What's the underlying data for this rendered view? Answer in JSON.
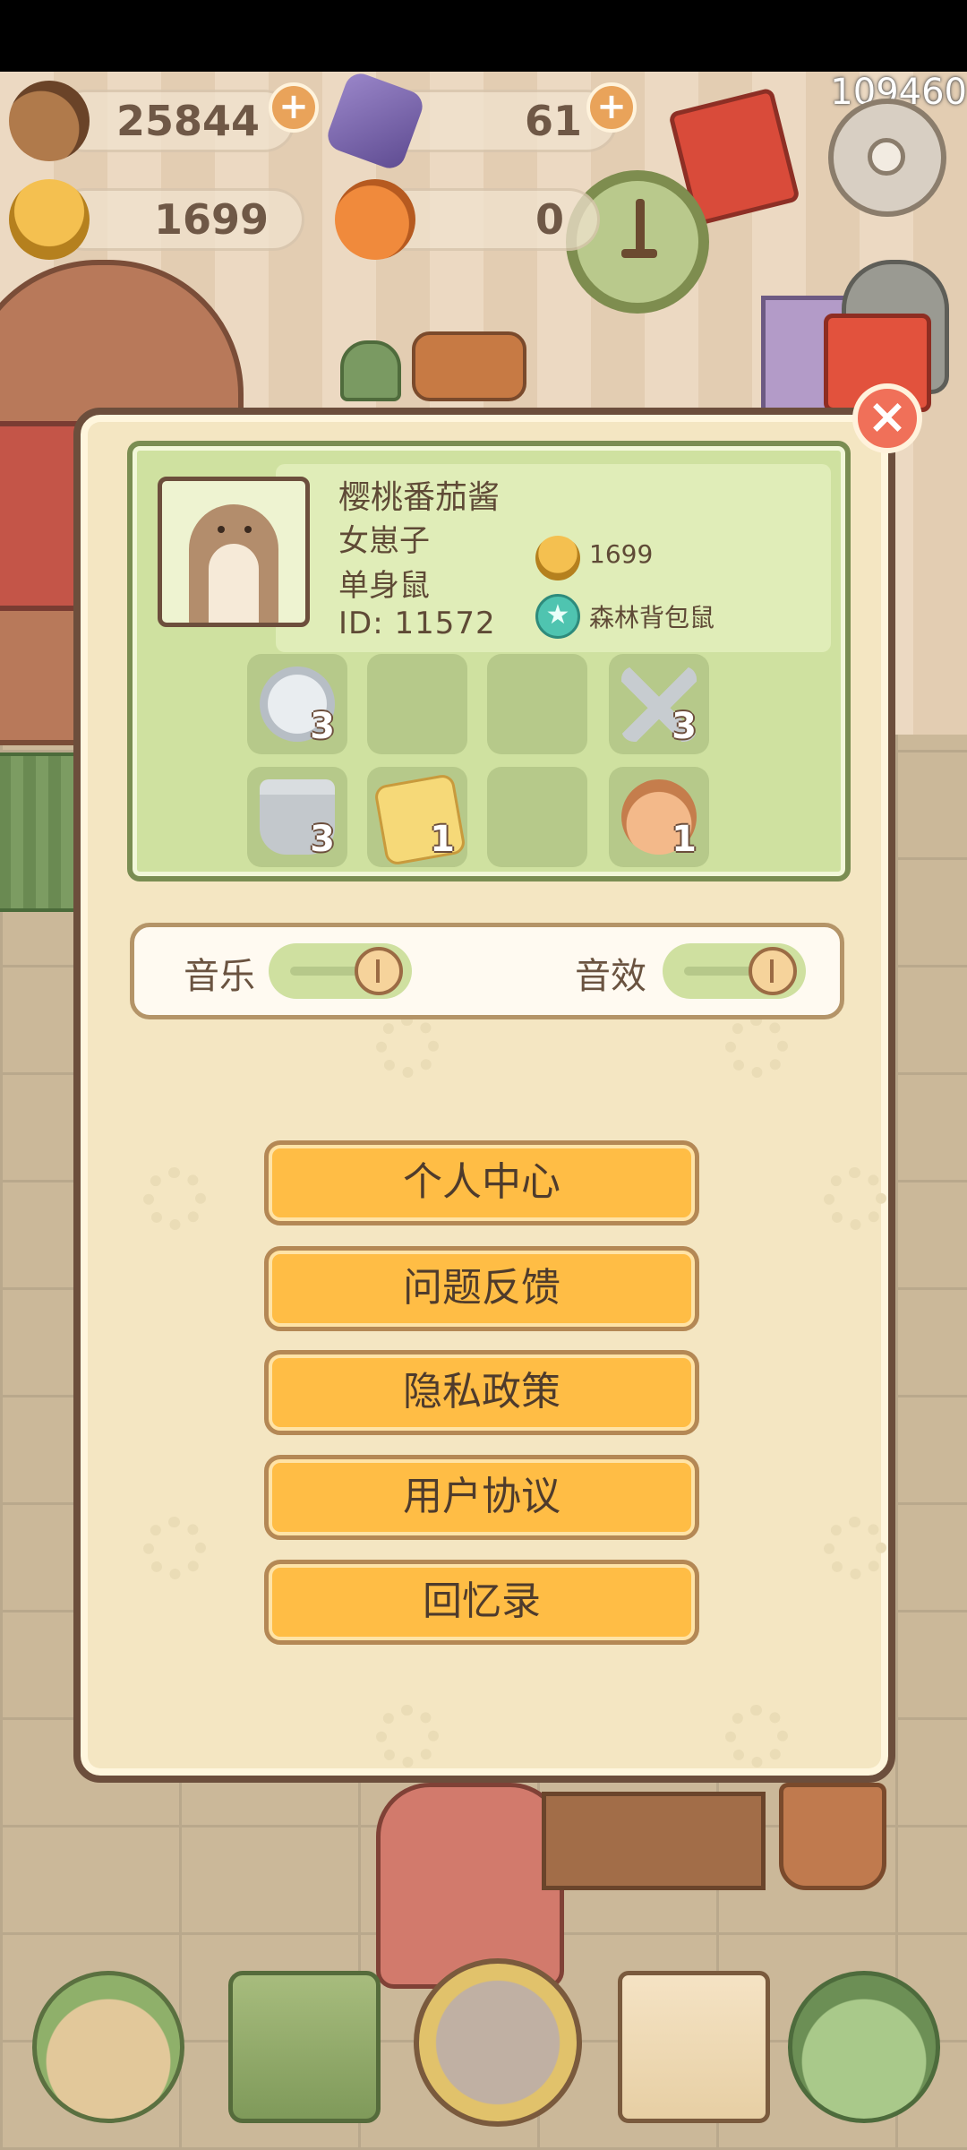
{
  "hud": {
    "points": "109460",
    "acorns": "25844",
    "gems": "61",
    "bells": "1699",
    "oranges": "0"
  },
  "profile": {
    "name": "樱桃番茄酱",
    "gender": "女崽子",
    "relationship": "单身鼠",
    "id": "ID: 11572",
    "bell_count": "1699",
    "badge_title": "森林背包鼠"
  },
  "inventory": [
    {
      "icon": "cabbage-icon",
      "count": "3"
    },
    {
      "icon": "",
      "count": ""
    },
    {
      "icon": "",
      "count": ""
    },
    {
      "icon": "scissors-icon",
      "count": "3"
    },
    {
      "icon": "pot-icon",
      "count": "3"
    },
    {
      "icon": "star-cards-icon",
      "count": "1"
    },
    {
      "icon": "",
      "count": ""
    },
    {
      "icon": "paw-icon",
      "count": "1"
    }
  ],
  "settings": {
    "music_label": "音乐",
    "sfx_label": "音效",
    "music_on": true,
    "sfx_on": true
  },
  "menu": {
    "personal_center": "个人中心",
    "feedback": "问题反馈",
    "privacy_policy": "隐私政策",
    "user_agreement": "用户协议",
    "memories": "回忆录"
  },
  "close_label": "×",
  "colors": {
    "panel_bg": "#f4e6c2",
    "button_orange": "#ffbd45",
    "profile_green": "#cfe1a0",
    "close_red": "#f07059"
  }
}
